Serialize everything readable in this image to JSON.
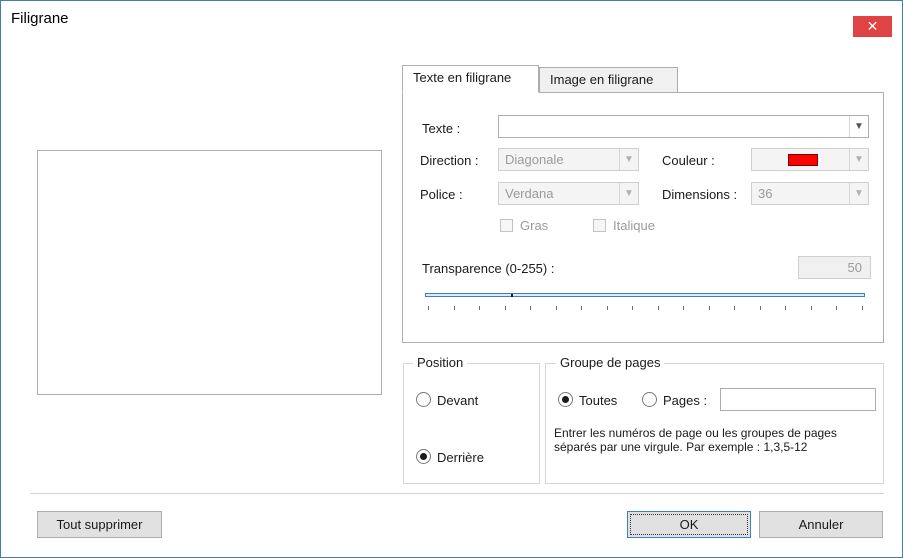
{
  "window": {
    "title": "Filigrane",
    "close_glyph": "✕"
  },
  "tabs": [
    {
      "label": "Texte en filigrane",
      "active": true
    },
    {
      "label": "Image en filigrane",
      "active": false
    }
  ],
  "text_tab": {
    "text_label": "Texte :",
    "text_value": "",
    "direction_label": "Direction :",
    "direction_value": "Diagonale",
    "color_label": "Couleur :",
    "color_value": "#ff0000",
    "font_label": "Police :",
    "font_value": "Verdana",
    "size_label": "Dimensions :",
    "size_value": "36",
    "bold_label": "Gras",
    "italic_label": "Italique",
    "transparency_label": "Transparence (0-255) :",
    "transparency_value": "50",
    "slider_value": 50,
    "slider_min": 0,
    "slider_max": 255
  },
  "position": {
    "title": "Position",
    "front_label": "Devant",
    "back_label": "Derrière",
    "selected": "back"
  },
  "page_group": {
    "title": "Groupe de pages",
    "all_label": "Toutes",
    "pages_label": "Pages :",
    "pages_value": "",
    "selected": "all",
    "note": "Entrer les numéros de page ou les groupes de pages séparés par une virgule. Par exemple : 1,3,5-12"
  },
  "buttons": {
    "clear_all": "Tout supprimer",
    "ok": "OK",
    "cancel": "Annuler"
  },
  "colors": {
    "close_button": "#e04343",
    "accent": "#3b7fc4",
    "swatch": "#ff0000"
  }
}
